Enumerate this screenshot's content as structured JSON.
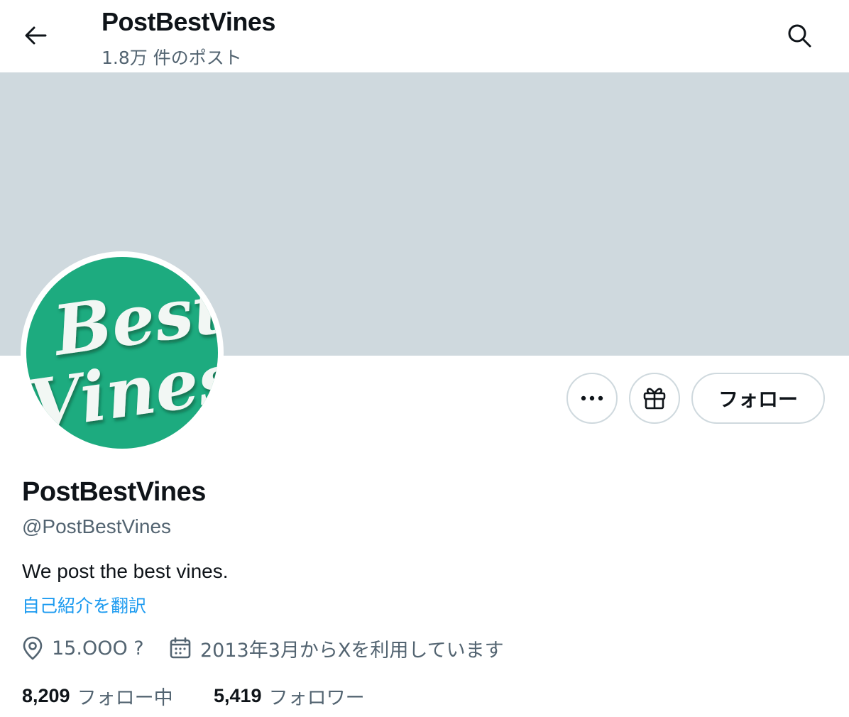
{
  "header": {
    "title": "PostBestVines",
    "post_count": "1.8万 件のポスト"
  },
  "profile": {
    "avatar_text_line1": "Best",
    "avatar_text_line2": "Vines",
    "avatar_color": "#1dab7f",
    "banner_color": "#cfd9de",
    "display_name": "PostBestVines",
    "handle": "@PostBestVines",
    "bio": "We post the best vines.",
    "translate_bio": "自己紹介を翻訳",
    "location": "15.OOO ?",
    "joined": "2013年3月からXを利用しています",
    "following_count": "8,209",
    "following_label": "フォロー中",
    "followers_count": "5,419",
    "followers_label": "フォロワー"
  },
  "actions": {
    "more_icon": "more-icon",
    "gift_icon": "gift-icon",
    "follow_label": "フォロー"
  },
  "colors": {
    "accent": "#1d9bf0",
    "text_primary": "#0f1419",
    "text_secondary": "#536471"
  }
}
